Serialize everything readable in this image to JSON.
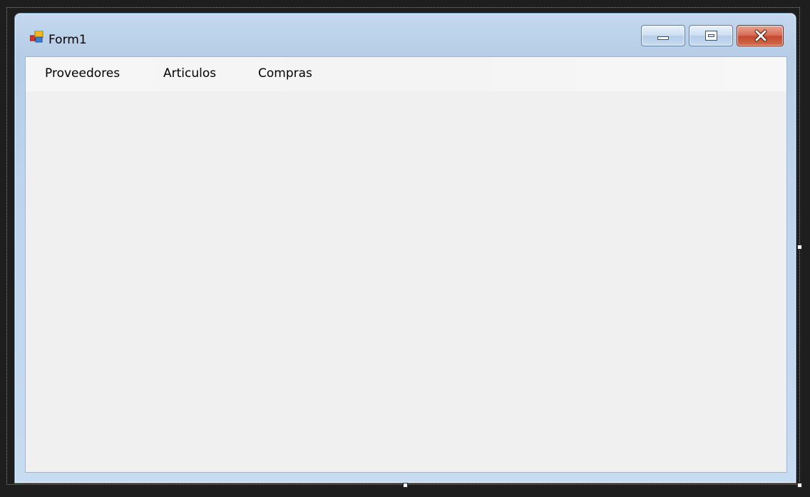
{
  "window": {
    "title": "Form1",
    "icon": "winforms-form-icon"
  },
  "caption_buttons": {
    "minimize": "minimize-icon",
    "maximize": "maximize-icon",
    "close": "close-icon"
  },
  "menu": {
    "items": [
      {
        "label": "Proveedores"
      },
      {
        "label": "Articulos"
      },
      {
        "label": "Compras"
      }
    ]
  },
  "colors": {
    "frame": "#bcd3ec",
    "client": "#f0f0f0",
    "close_button": "#c24a2f",
    "designer_background": "#1e1e1e"
  }
}
